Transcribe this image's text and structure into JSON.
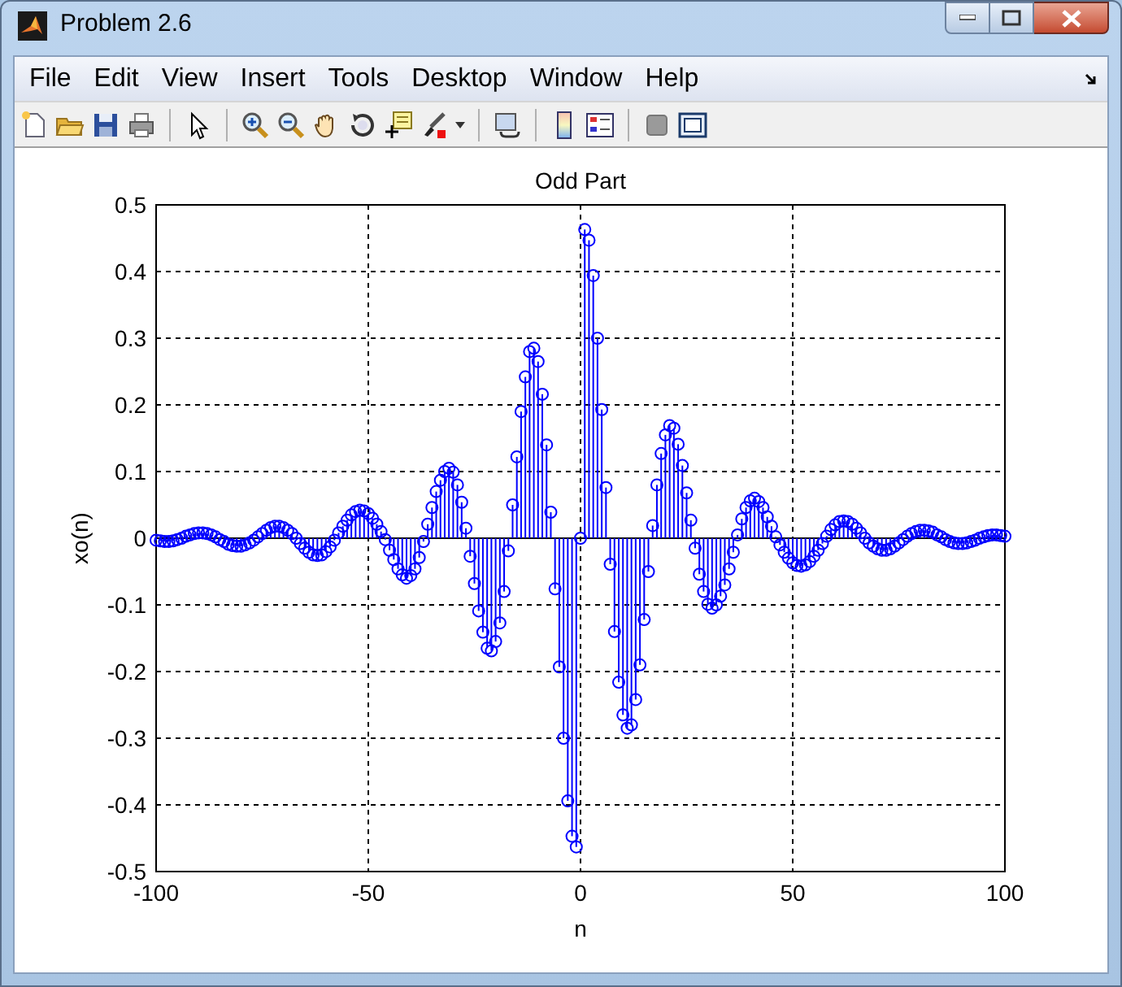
{
  "window": {
    "title": "Problem 2.6"
  },
  "menu": [
    {
      "label": "File"
    },
    {
      "label": "Edit"
    },
    {
      "label": "View"
    },
    {
      "label": "Insert"
    },
    {
      "label": "Tools"
    },
    {
      "label": "Desktop"
    },
    {
      "label": "Window"
    },
    {
      "label": "Help"
    }
  ],
  "plot": {
    "chart_data": {
      "type": "scatter",
      "title": "Odd Part",
      "xlabel": "n",
      "ylabel": "xo(n)",
      "xlim": [
        -100,
        100
      ],
      "ylim": [
        -0.5,
        0.5
      ],
      "grid": true,
      "xticks": [
        -100,
        -50,
        0,
        50,
        100
      ],
      "yticks": [
        -0.5,
        -0.4,
        -0.3,
        -0.2,
        -0.1,
        0,
        0.1,
        0.2,
        0.3,
        0.4,
        0.5
      ],
      "x": [
        -100,
        -99,
        -98,
        -97,
        -96,
        -95,
        -94,
        -93,
        -92,
        -91,
        -90,
        -89,
        -88,
        -87,
        -86,
        -85,
        -84,
        -83,
        -82,
        -81,
        -80,
        -79,
        -78,
        -77,
        -76,
        -75,
        -74,
        -73,
        -72,
        -71,
        -70,
        -69,
        -68,
        -67,
        -66,
        -65,
        -64,
        -63,
        -62,
        -61,
        -60,
        -59,
        -58,
        -57,
        -56,
        -55,
        -54,
        -53,
        -52,
        -51,
        -50,
        -49,
        -48,
        -47,
        -46,
        -45,
        -44,
        -43,
        -42,
        -41,
        -40,
        -39,
        -38,
        -37,
        -36,
        -35,
        -34,
        -33,
        -32,
        -31,
        -30,
        -29,
        -28,
        -27,
        -26,
        -25,
        -24,
        -23,
        -22,
        -21,
        -20,
        -19,
        -18,
        -17,
        -16,
        -15,
        -14,
        -13,
        -12,
        -11,
        -10,
        -9,
        -8,
        -7,
        -6,
        -5,
        -4,
        -3,
        -2,
        -1,
        0,
        1,
        2,
        3,
        4,
        5,
        6,
        7,
        8,
        9,
        10,
        11,
        12,
        13,
        14,
        15,
        16,
        17,
        18,
        19,
        20,
        21,
        22,
        23,
        24,
        25,
        26,
        27,
        28,
        29,
        30,
        31,
        32,
        33,
        34,
        35,
        36,
        37,
        38,
        39,
        40,
        41,
        42,
        43,
        44,
        45,
        46,
        47,
        48,
        49,
        50,
        51,
        52,
        53,
        54,
        55,
        56,
        57,
        58,
        59,
        60,
        61,
        62,
        63,
        64,
        65,
        66,
        67,
        68,
        69,
        70,
        71,
        72,
        73,
        74,
        75,
        76,
        77,
        78,
        79,
        80,
        81,
        82,
        83,
        84,
        85,
        86,
        87,
        88,
        89,
        90,
        91,
        92,
        93,
        94,
        95,
        96,
        97,
        98,
        99,
        100
      ],
      "series": [
        {
          "color": "#0000ff",
          "values": [
            -0.003,
            -0.004,
            -0.005,
            -0.005,
            -0.004,
            -0.002,
            0,
            0.003,
            0.005,
            0.007,
            0.008,
            0.008,
            0.007,
            0.005,
            0.002,
            -0.002,
            -0.005,
            -0.009,
            -0.011,
            -0.012,
            -0.012,
            -0.01,
            -0.007,
            -0.003,
            0.002,
            0.007,
            0.012,
            0.016,
            0.018,
            0.018,
            0.016,
            0.012,
            0.007,
            0,
            -0.008,
            -0.015,
            -0.021,
            -0.025,
            -0.026,
            -0.025,
            -0.02,
            -0.013,
            -0.003,
            0.008,
            0.018,
            0.027,
            0.035,
            0.04,
            0.042,
            0.041,
            0.037,
            0.03,
            0.021,
            0.01,
            -0.002,
            -0.018,
            -0.032,
            -0.046,
            -0.055,
            -0.06,
            -0.056,
            -0.046,
            -0.029,
            -0.005,
            0.021,
            0.046,
            0.07,
            0.087,
            0.1,
            0.105,
            0.099,
            0.08,
            0.054,
            0.015,
            -0.027,
            -0.068,
            -0.109,
            -0.141,
            -0.165,
            -0.169,
            -0.155,
            -0.127,
            -0.08,
            -0.019,
            0.05,
            0.122,
            0.19,
            0.242,
            0.28,
            0.285,
            0.265,
            0.216,
            0.14,
            0.039,
            -0.076,
            -0.193,
            -0.3,
            -0.394,
            -0.447,
            -0.463,
            0,
            0.463,
            0.447,
            0.394,
            0.3,
            0.193,
            0.076,
            -0.039,
            -0.14,
            -0.216,
            -0.265,
            -0.285,
            -0.28,
            -0.242,
            -0.19,
            -0.122,
            -0.05,
            0.019,
            0.08,
            0.127,
            0.155,
            0.169,
            0.165,
            0.141,
            0.109,
            0.068,
            0.027,
            -0.015,
            -0.054,
            -0.08,
            -0.099,
            -0.105,
            -0.1,
            -0.087,
            -0.07,
            -0.046,
            -0.021,
            0.005,
            0.029,
            0.046,
            0.056,
            0.06,
            0.055,
            0.046,
            0.032,
            0.018,
            0.002,
            -0.01,
            -0.021,
            -0.03,
            -0.037,
            -0.041,
            -0.042,
            -0.04,
            -0.035,
            -0.027,
            -0.018,
            -0.008,
            0.003,
            0.013,
            0.02,
            0.025,
            0.026,
            0.025,
            0.021,
            0.015,
            0.008,
            0,
            -0.007,
            -0.012,
            -0.016,
            -0.018,
            -0.018,
            -0.016,
            -0.012,
            -0.007,
            -0.002,
            0.003,
            0.007,
            0.01,
            0.012,
            0.012,
            0.011,
            0.009,
            0.005,
            0.002,
            -0.002,
            -0.005,
            -0.007,
            -0.008,
            -0.008,
            -0.007,
            -0.005,
            -0.003,
            0,
            0.002,
            0.004,
            0.005,
            0.005,
            0.004,
            0.003
          ]
        }
      ]
    }
  }
}
